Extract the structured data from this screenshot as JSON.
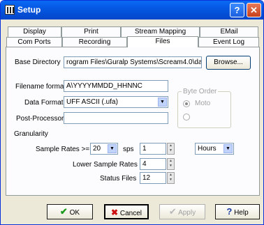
{
  "window": {
    "title": "Setup",
    "help_glyph": "?",
    "close_glyph": "✕"
  },
  "tabs_row1": [
    {
      "label": "Display"
    },
    {
      "label": "Print"
    },
    {
      "label": "Stream Mapping"
    },
    {
      "label": "EMail"
    }
  ],
  "tabs_row2": [
    {
      "label": "Com Ports"
    },
    {
      "label": "Recording"
    },
    {
      "label": "Files"
    },
    {
      "label": "Event Log"
    }
  ],
  "files": {
    "base_directory_label": "Base Directory",
    "base_directory_value": "rogram Files\\Guralp Systems\\Scream4.0\\data",
    "browse_label": "Browse...",
    "filename_format_label": "Filename format",
    "filename_format_value": "A\\YYYYMMDD_HHNNC",
    "data_format_label": "Data Format",
    "data_format_value": "UFF ASCII (.ufa)",
    "post_processor_label": "Post-Processor",
    "post_processor_value": "",
    "byte_order_label": "Byte Order",
    "byte_order_option1": "Moto"
  },
  "granularity": {
    "label": "Granularity",
    "sample_rates_label": "Sample Rates >=",
    "sample_rate_value": "20",
    "sps_label": "sps",
    "sps_value": "1",
    "unit_value": "Hours",
    "lower_sample_rates_label": "Lower Sample Rates",
    "lower_sample_rates_value": "4",
    "status_files_label": "Status Files",
    "status_files_value": "12"
  },
  "footer": {
    "ok_label": "OK",
    "cancel_label": "Cancel",
    "apply_label": "Apply",
    "help_label": "Help"
  },
  "colors": {
    "accent": "#0558e3",
    "ok_check": "#1a9a1a",
    "cancel_x": "#cc1010"
  }
}
